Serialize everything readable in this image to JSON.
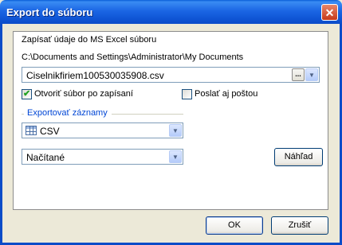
{
  "window": {
    "title": "Export do súboru",
    "close_label": "✕"
  },
  "panel": {
    "heading": "Zapísať údaje do MS Excel súboru",
    "path": "C:\\Documents and Settings\\Administrator\\My Documents",
    "file": {
      "value": "Ciselnikfiriem100530035908.csv",
      "browse_label": "..."
    },
    "open_after_save": {
      "label": "Otvoriť súbor po zapísaní",
      "checked": true
    },
    "send_mail": {
      "label": "Poslať aj poštou",
      "checked": false
    },
    "export_records": {
      "label": "Exportovať záznamy",
      "format": {
        "value": "CSV"
      },
      "scope": {
        "value": "Načítané"
      },
      "preview_label": "Náhľad"
    }
  },
  "footer": {
    "ok_label": "OK",
    "cancel_label": "Zrušiť"
  }
}
